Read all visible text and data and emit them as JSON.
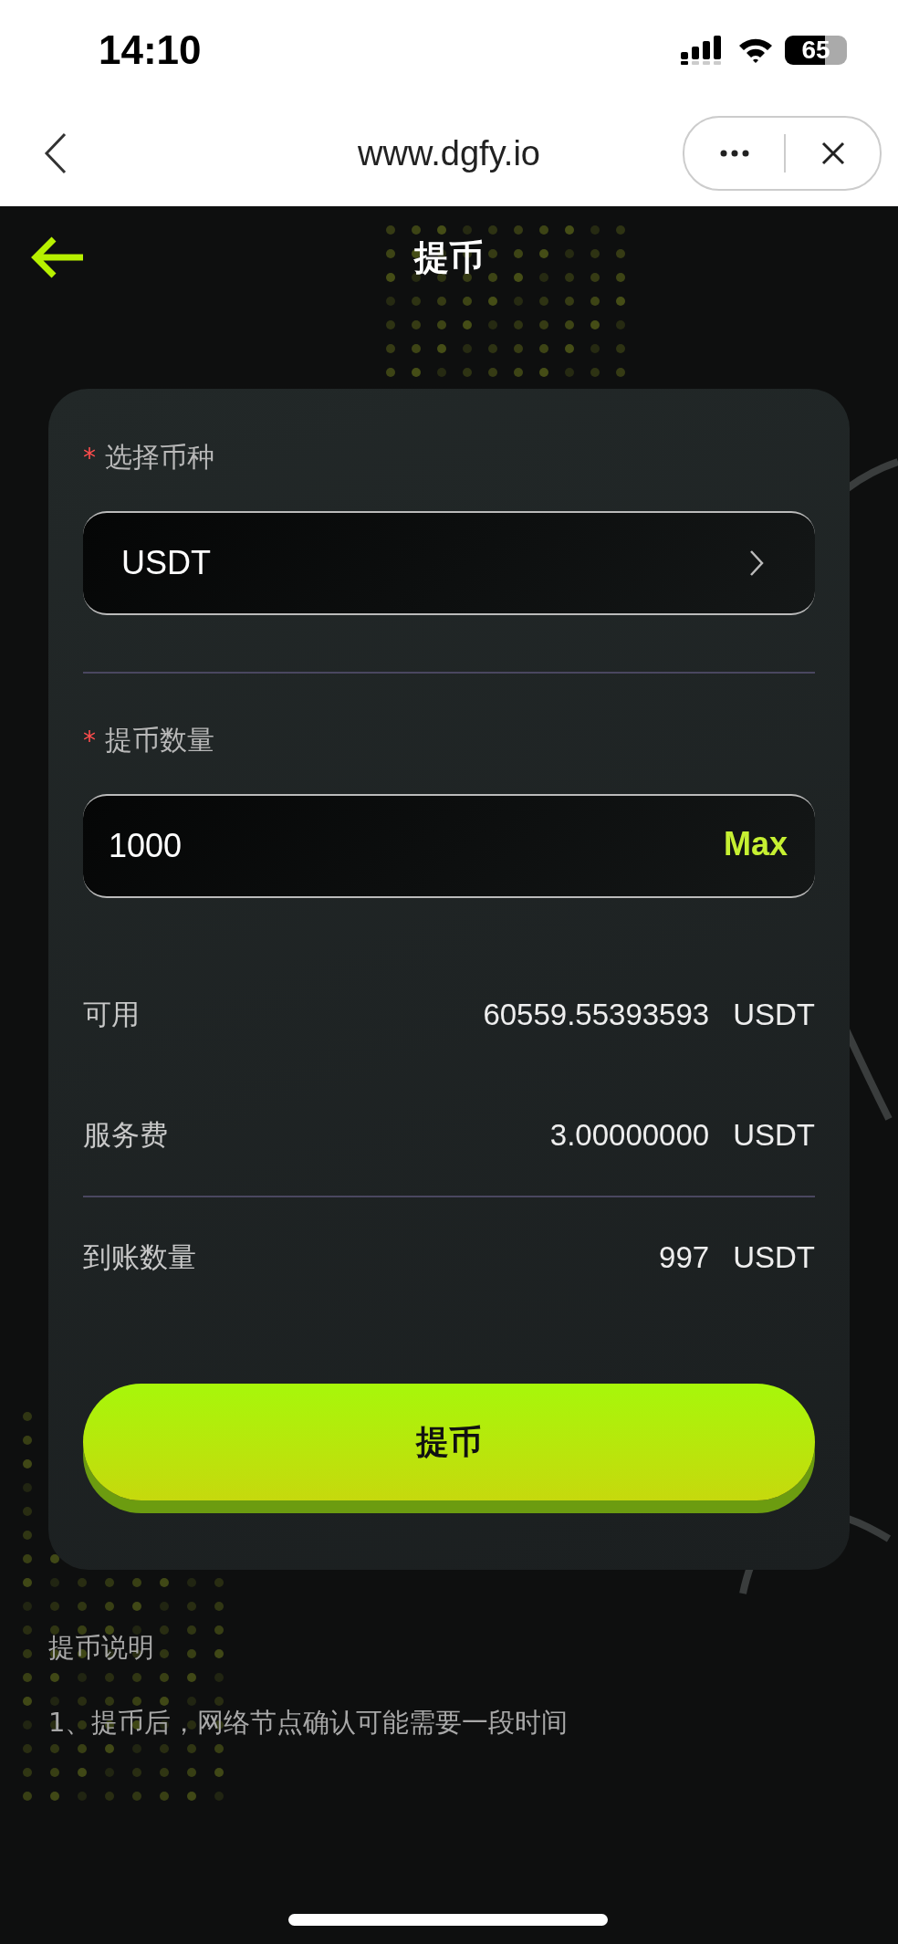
{
  "status_bar": {
    "time": "14:10",
    "battery": "65"
  },
  "browser_bar": {
    "url": "www.dgfy.io"
  },
  "header": {
    "title": "提币"
  },
  "form": {
    "fields": [
      {
        "kind": "select",
        "required_mark": "*",
        "label": "选择币种",
        "value": "USDT"
      },
      {
        "kind": "input",
        "required_mark": "*",
        "label": "提币数量",
        "value": "1000",
        "action": "Max"
      }
    ]
  },
  "summary": {
    "rows": [
      {
        "label": "可用",
        "amount": "60559.55393593",
        "unit": "USDT",
        "divider_above": false
      },
      {
        "label": "服务费",
        "amount": "3.00000000",
        "unit": "USDT",
        "divider_above": false
      },
      {
        "label": "到账数量",
        "amount": "997",
        "unit": "USDT",
        "divider_above": true
      }
    ]
  },
  "submit_button": {
    "label": "提币"
  },
  "notes": {
    "title": "提币说明",
    "items": [
      "1、提币后，网络节点确认可能需要一段时间"
    ]
  }
}
